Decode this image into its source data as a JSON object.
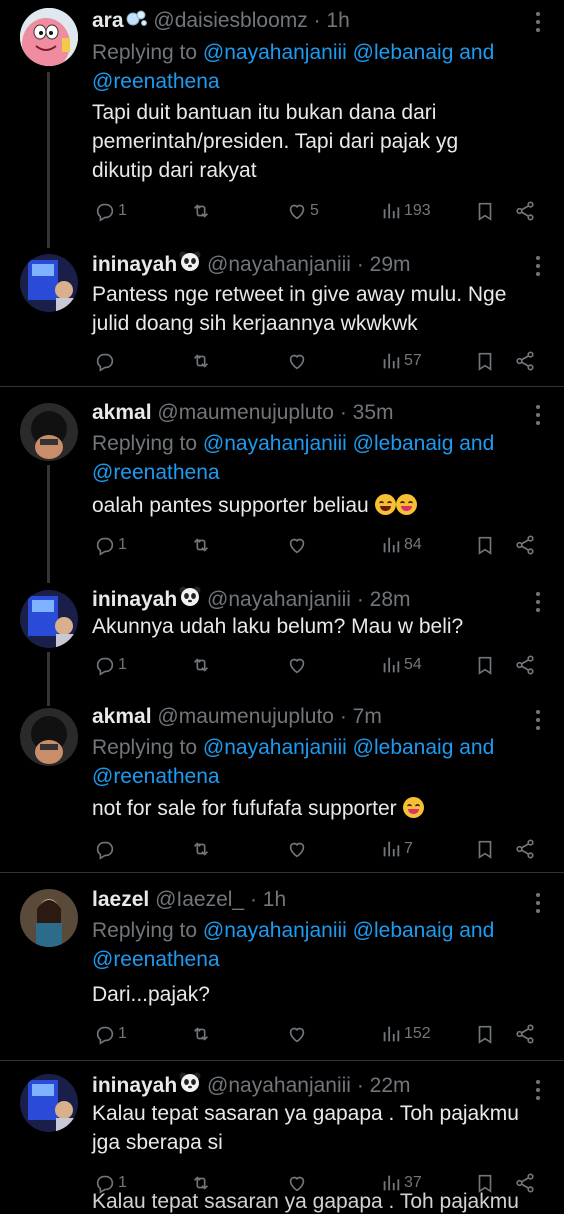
{
  "tweets": [
    {
      "name": "ara",
      "handle": "@daisiesbloomz",
      "time": "· 1h",
      "avatar_icon": "patrick-star-avatar",
      "reply_prefix": "Replying to",
      "reply_mentions": "@nayahanjaniii @lebanaig and",
      "reply_mentions2": "@reenathena",
      "text": [
        "Tapi duit bantuan itu bukan dana dari",
        "pemerintah/presiden. Tapi dari pajak yg",
        "dikutip dari rakyat"
      ],
      "replies": "1",
      "likes": "5",
      "views": "193"
    },
    {
      "name": "ininayah",
      "handle": "@nayahanjaniii",
      "time": "· 29m",
      "avatar_icon": "blue-neon-photo-avatar",
      "text": [
        "Pantess nge retweet in give away mulu. Nge",
        "julid doang sih kerjaannya wkwkwk"
      ],
      "replies": "",
      "likes": "",
      "views": "57"
    },
    {
      "name": "akmal",
      "handle": "@maumenujupluto",
      "time": "· 35m",
      "avatar_icon": "dark-photo-avatar",
      "reply_prefix": "Replying to",
      "reply_mentions": "@nayahanjaniii @lebanaig and",
      "reply_mentions2": "@reenathena",
      "text": [
        "oalah pantes supporter beliau"
      ],
      "replies": "1",
      "likes": "",
      "views": "84"
    },
    {
      "name": "ininayah",
      "handle": "@nayahanjaniii",
      "time": "· 28m",
      "avatar_icon": "blue-neon-photo-avatar",
      "text": [
        "Akunnya udah laku belum? Mau w beli?"
      ],
      "replies": "1",
      "likes": "",
      "views": "54"
    },
    {
      "name": "akmal",
      "handle": "@maumenujupluto",
      "time": "· 7m",
      "avatar_icon": "dark-photo-avatar",
      "reply_prefix": "Replying to",
      "reply_mentions": "@nayahanjaniii @lebanaig and",
      "reply_mentions2": "@reenathena",
      "text": [
        "not for sale for fufufafa supporter"
      ],
      "replies": "",
      "likes": "",
      "views": "7"
    },
    {
      "name": "laezel",
      "handle": "@Iaezel_",
      "time": "· 1h",
      "avatar_icon": "girl-photo-avatar",
      "reply_prefix": "Replying to",
      "reply_mentions": "@nayahanjaniii @lebanaig and",
      "reply_mentions2": "@reenathena",
      "text": [
        "Dari...pajak?"
      ],
      "replies": "1",
      "likes": "",
      "views": "152"
    },
    {
      "name": "ininayah",
      "handle": "@nayahanjaniii",
      "time": "· 22m",
      "avatar_icon": "blue-neon-photo-avatar",
      "text": [
        "Kalau tepat sasaran ya gapapa . Toh pajakmu",
        "jga sberapa si"
      ],
      "replies": "1",
      "likes": "",
      "views": "37"
    }
  ],
  "cut_text": "Kalau tepat sasaran ya gapapa . Toh pajakmu",
  "colors": {
    "background": "#000000",
    "text": "#e7e9ea",
    "muted": "#71767b",
    "link": "#1d9bf0",
    "divider": "#2f3336"
  }
}
